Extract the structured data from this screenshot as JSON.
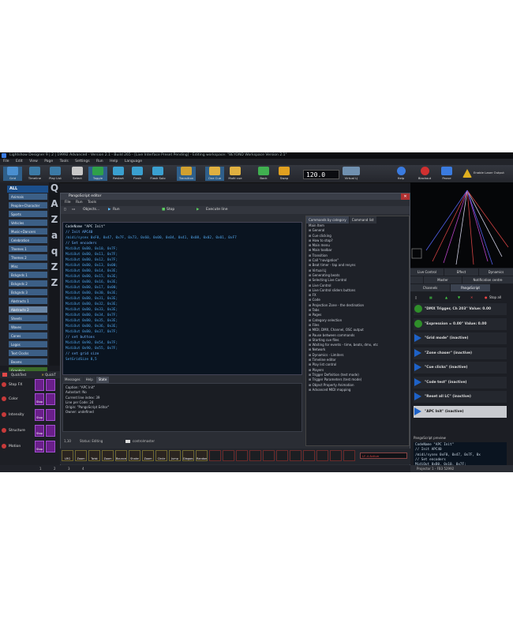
{
  "window": {
    "title": "Lightshow Designer 9 | 2 | 19992 Advanced - Version 2.1 - Build 265 - [Live Interface Preset Pending] - Editing workspace: \"BEYOND Workspace Version 2.1\""
  },
  "menu": [
    "File",
    "Edit",
    "View",
    "Page",
    "Tools",
    "Settings",
    "Run",
    "Help",
    "Language"
  ],
  "toolbar": {
    "items": [
      "Grid",
      "Timeline",
      "Play List",
      "Select",
      "Toggle",
      "Restart",
      "Flash",
      "Flash Solo",
      "Transition",
      "One Cue",
      "Multi cue",
      "Back",
      "Swap",
      "Virtual LJ",
      "Help",
      "Blackout",
      "Pause",
      "Enable Laser Output"
    ],
    "bpm": "120.0"
  },
  "sidebar": {
    "all_label": "ALL",
    "items": [
      "Animals",
      "People+Character",
      "Sports",
      "Vehicles",
      "Music+Dancers",
      "Celebration",
      "Themes 1",
      "Themes 2",
      "Misc",
      "Bckgnds 1",
      "Bckgnds 2",
      "Bckgnds 3",
      "Abstracts 1",
      "Abstracts 2",
      "Sheets",
      "Waves",
      "Cones",
      "Logos",
      "Text Clocks",
      "Beams",
      "Graphics",
      "Atmospherics"
    ],
    "grid_letters": [
      "Q",
      "A",
      "Z",
      "a",
      "q",
      "Z",
      "Z"
    ]
  },
  "editor": {
    "title": "PangoScript editor",
    "menu": [
      "File",
      "Run",
      "Tools"
    ],
    "tools": [
      "Objects...",
      "Run",
      "Stop",
      "Execute line"
    ],
    "code": [
      "CodeName \"APC Init\"",
      "// Init APC40",
      "/midi/sysex 0xF0, 0x47, 0x7F, 0x73, 0x60, 0x00, 0x04, 0x41, 0x08, 0x02, 0x01, 0xF7",
      "// Set encoders",
      "MidiOut 0xB0, 0x10, 0x7F;",
      "MidiOut 0xB0, 0x11, 0x7F;",
      "MidiOut 0xB0, 0x12, 0x7F;",
      "MidiOut 0xB0, 0x13, 0x00;",
      "MidiOut 0xB0, 0x14, 0x3E;",
      "MidiOut 0xB0, 0x15, 0x3E;",
      "MidiOut 0xB0, 0x16, 0x3E;",
      "MidiOut 0xB0, 0x17, 0x00;",
      "MidiOut 0xB0, 0x30, 0x3E;",
      "MidiOut 0xB0, 0x31, 0x3E;",
      "MidiOut 0xB0, 0x32, 0x3E;",
      "MidiOut 0xB0, 0x33, 0x3E;",
      "MidiOut 0xB0, 0x34, 0x7F;",
      "MidiOut 0xB0, 0x35, 0x3E;",
      "MidiOut 0xB0, 0x36, 0x3E;",
      "MidiOut 0xB0, 0x37, 0x7F;",
      "// set buttons",
      "MidiOut 0x90, 0x54, 0x7F;",
      "MidiOut 0x90, 0x55, 0x7F;",
      "// set grid size",
      "SetGridSize 8,5"
    ],
    "bottom_tabs": [
      "Messages",
      "Help",
      "State"
    ],
    "state": [
      "Caption: \"APC Init\"",
      "Autostart: No",
      "Current line index: 39",
      "Line per Code: 24",
      "Origin: \"PangoScript Editor\"",
      "Owner: undefined"
    ],
    "status_pos": "1,10",
    "status_mode": "Status: Editing",
    "status_ctrl": "controlmaster",
    "ok": "OK",
    "cancel": "Cancel"
  },
  "commands": {
    "tabs": [
      "Commands by category",
      "Command list"
    ],
    "root": "Main Item",
    "items": [
      "General",
      "Cue clicking",
      "How to stop?",
      "Main menu",
      "Main toolbar",
      "Transition",
      "Call \"navigation\"",
      "Beat timer - tap and resyns",
      "Virtual LJ",
      "Generating beats",
      "Selecting Live Control",
      "Live Control",
      "Live Control sliders buttons",
      "FX",
      "Code",
      "Projection Zone - the destination",
      "Tabs",
      "Pages",
      "Category selection",
      "Files",
      "MIDI, DMX, Channel, OSC output",
      "Pause between commands",
      "Starting cue files",
      "Waiting for events - time, beats, dmx, etc",
      "Network",
      "Dynamics - Limiters",
      "Timeline editor",
      "Play list control",
      "Players",
      "Trigger Definition (test mode)",
      "Trigger Parameters (test mode)",
      "Object Property Animation",
      "Advanced MIDI mapping"
    ]
  },
  "right": {
    "tabs1": [
      "Live Control",
      "Effect",
      "Dynamics"
    ],
    "tabs2": [
      "Master",
      "Notification centre"
    ],
    "tabs3": [
      "Channels",
      "PangoScript"
    ],
    "stop_all": "Stop all",
    "scripts": [
      {
        "label": "\"DMX Trigger, Ch 203\" Value: 0.00",
        "kind": "green"
      },
      {
        "label": "\"Expression = 0.00\" Value: 0.00",
        "kind": "green"
      },
      {
        "label": "\"Grid mode\" (inactive)",
        "kind": "play"
      },
      {
        "label": "\"Zone chaser\" (inactive)",
        "kind": "play"
      },
      {
        "label": "\"Cue clicks\" (inactive)",
        "kind": "play"
      },
      {
        "label": "\"Code test\" (inactive)",
        "kind": "play"
      },
      {
        "label": "\"Reset all LC\" (inactive)",
        "kind": "play"
      },
      {
        "label": "\"APC Init\" (inactive)",
        "kind": "play"
      }
    ],
    "preview_title": "PangoScript preview",
    "preview_code": [
      "CodeName \"APC Init\"",
      "// Init APC40",
      "/midi/sysex 0xF0, 0x47, 0x7F, 0x",
      "// Set encoders",
      "MidiOut 0xB0, 0x10, 0x7F;",
      "MidiOut 0xB0, 0x11, 0x7F;",
      "MidiOut 0xB0, 0x13, 0x00;"
    ],
    "projector": "Projector 1 - FB3 52992"
  },
  "quicktest": {
    "header": [
      "QuickTest",
      "QuickT"
    ],
    "stop_fx": "Stop FX",
    "rows": [
      "Color",
      "Intensity",
      "Structure",
      "Motion"
    ],
    "stop_word": "Stop"
  },
  "strip": {
    "items": [
      "LRG Rainbow",
      "Zoom",
      "Twist",
      "Zoom",
      "Bounce",
      "Shake",
      "Zoom Thru",
      "Circle",
      "Jump",
      "Diagonal",
      "Random"
    ],
    "info": "LF-4 Active"
  },
  "pages": [
    "1",
    "2",
    "3",
    "4"
  ]
}
